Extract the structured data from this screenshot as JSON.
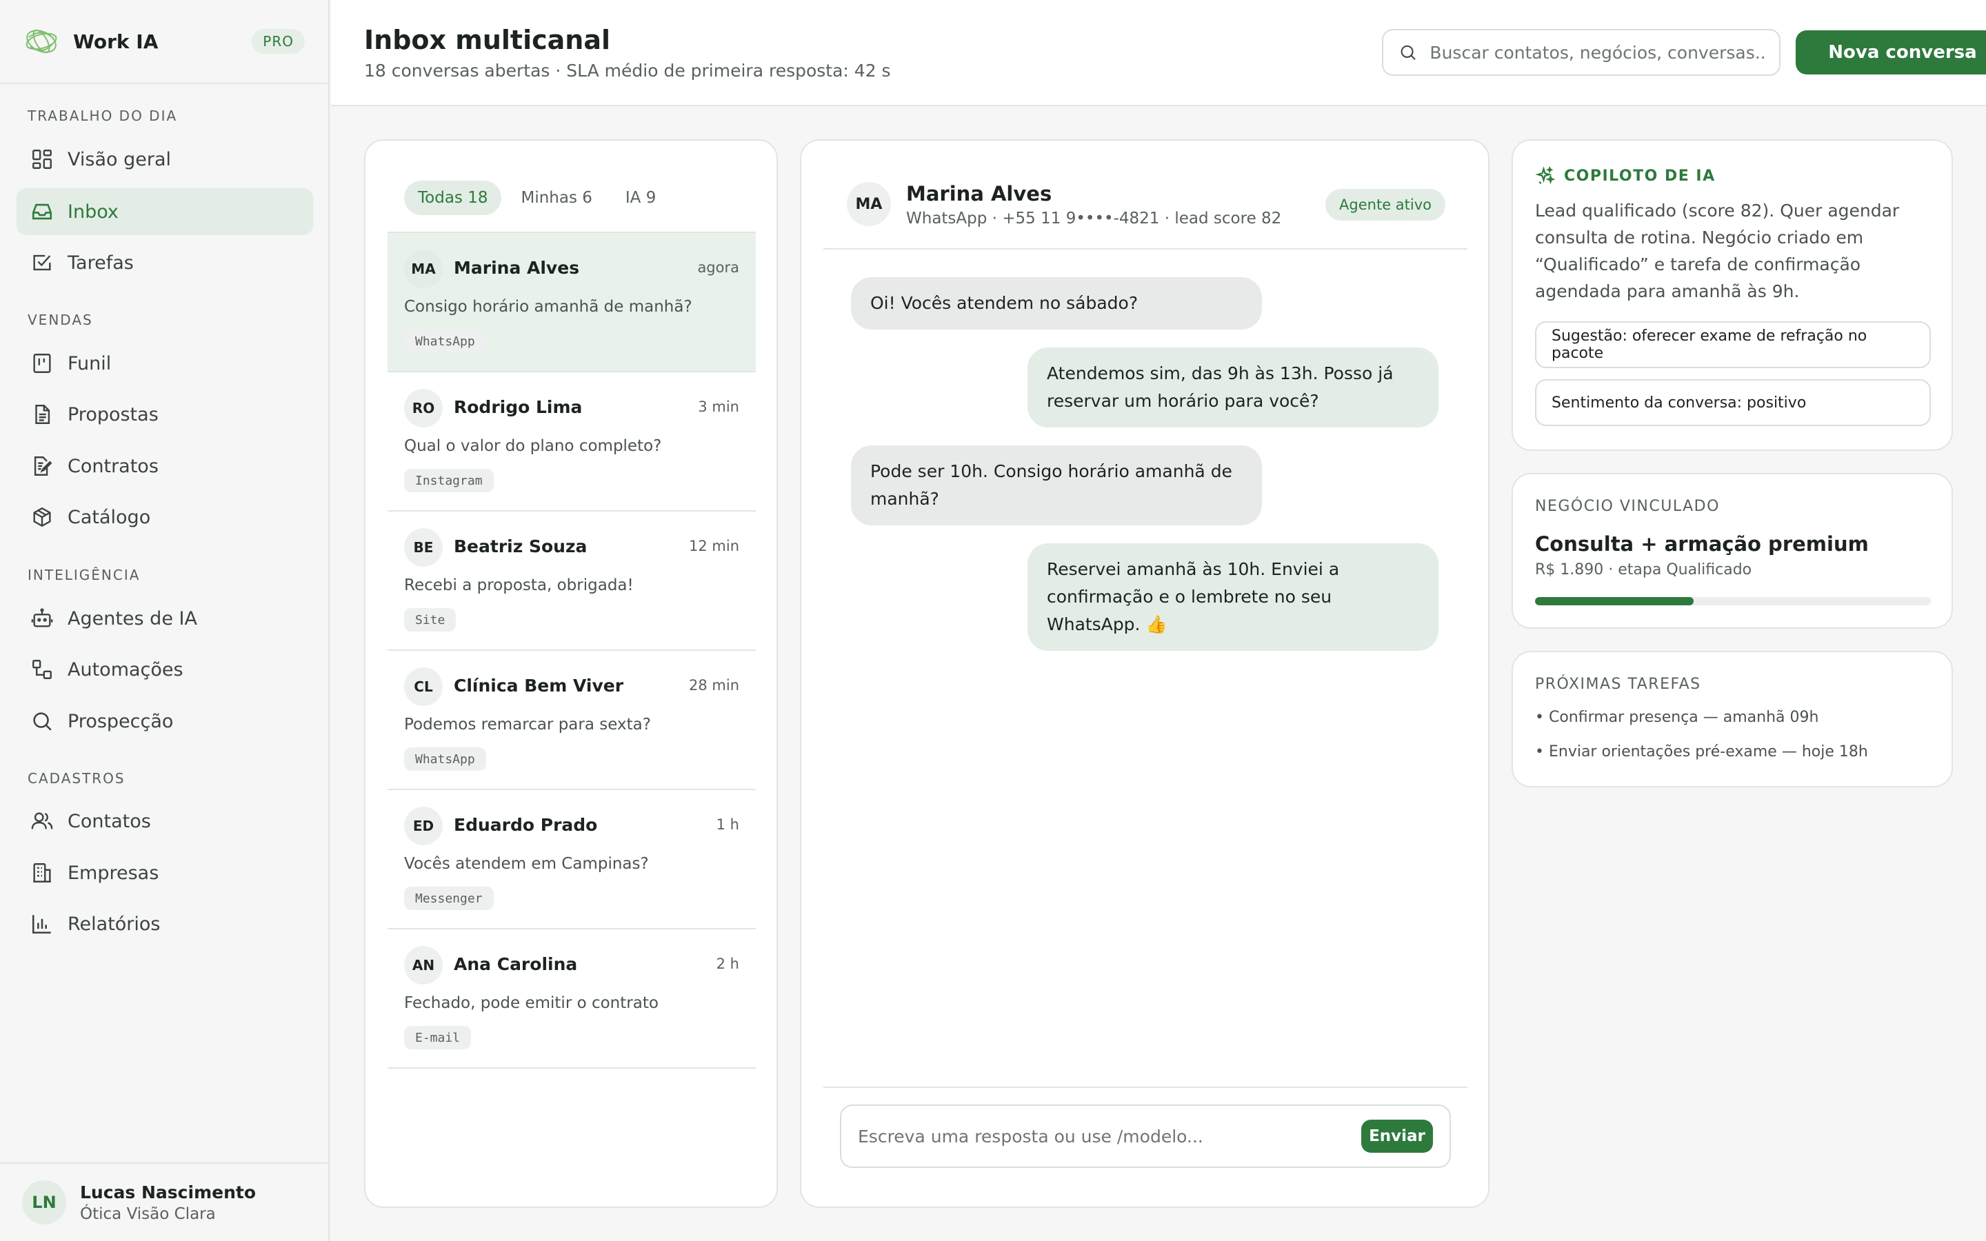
{
  "app": {
    "name": "Work IA",
    "plan_badge": "PRO"
  },
  "sidebar": {
    "sections": [
      {
        "title": "TRABALHO DO DIA",
        "items": [
          {
            "label": "Visão geral",
            "icon": "grid-icon"
          },
          {
            "label": "Inbox",
            "icon": "inbox-icon",
            "active": true
          },
          {
            "label": "Tarefas",
            "icon": "checkbox-icon"
          }
        ]
      },
      {
        "title": "VENDAS",
        "items": [
          {
            "label": "Funil",
            "icon": "kanban-icon"
          },
          {
            "label": "Propostas",
            "icon": "document-icon"
          },
          {
            "label": "Contratos",
            "icon": "contract-icon"
          },
          {
            "label": "Catálogo",
            "icon": "box-icon"
          }
        ]
      },
      {
        "title": "INTELIGÊNCIA",
        "items": [
          {
            "label": "Agentes de IA",
            "icon": "bot-icon"
          },
          {
            "label": "Automações",
            "icon": "workflow-icon"
          },
          {
            "label": "Prospecção",
            "icon": "search-icon"
          }
        ]
      },
      {
        "title": "CADASTROS",
        "items": [
          {
            "label": "Contatos",
            "icon": "users-icon"
          },
          {
            "label": "Empresas",
            "icon": "building-icon"
          },
          {
            "label": "Relatórios",
            "icon": "bar-chart-icon"
          }
        ]
      }
    ],
    "user": {
      "initials": "LN",
      "name": "Lucas Nascimento",
      "company": "Ótica Visão Clara"
    }
  },
  "header": {
    "title": "Inbox multicanal",
    "subtitle": "18 conversas abertas · SLA médio de primeira resposta: 42 s",
    "search_placeholder": "Buscar contatos, negócios, conversas...",
    "primary_button": "Nova conversa"
  },
  "conversations": {
    "tabs": [
      {
        "label": "Todas 18",
        "active": true
      },
      {
        "label": "Minhas 6"
      },
      {
        "label": "IA 9"
      }
    ],
    "items": [
      {
        "initials": "MA",
        "name": "Marina Alves",
        "time": "agora",
        "message": "Consigo horário amanhã de manhã?",
        "channel": "WhatsApp",
        "active": true
      },
      {
        "initials": "RO",
        "name": "Rodrigo Lima",
        "time": "3 min",
        "message": "Qual o valor do plano completo?",
        "channel": "Instagram"
      },
      {
        "initials": "BE",
        "name": "Beatriz Souza",
        "time": "12 min",
        "message": "Recebi a proposta, obrigada!",
        "channel": "Site"
      },
      {
        "initials": "CL",
        "name": "Clínica Bem Viver",
        "time": "28 min",
        "message": "Podemos remarcar para sexta?",
        "channel": "WhatsApp"
      },
      {
        "initials": "ED",
        "name": "Eduardo Prado",
        "time": "1 h",
        "message": "Vocês atendem em Campinas?",
        "channel": "Messenger"
      },
      {
        "initials": "AN",
        "name": "Ana Carolina",
        "time": "2 h",
        "message": "Fechado, pode emitir o contrato",
        "channel": "E-mail"
      }
    ]
  },
  "chat": {
    "contact_initials": "MA",
    "contact_name": "Marina Alves",
    "contact_meta": "WhatsApp · +55 11 9••••-4821 · lead score 82",
    "agent_status": "Agente ativo",
    "messages": [
      {
        "direction": "in",
        "text": "Oi! Vocês atendem no sábado?"
      },
      {
        "direction": "out",
        "text": "Atendemos sim, das 9h às 13h. Posso já reservar um horário para você?"
      },
      {
        "direction": "in",
        "text": "Pode ser 10h. Consigo horário amanhã de manhã?"
      },
      {
        "direction": "out",
        "text": "Reservei amanhã às 10h. Enviei a confirmação e o lembrete no seu WhatsApp. 👍"
      }
    ],
    "composer_placeholder": "Escreva uma resposta ou use /modelo...",
    "send_label": "Enviar"
  },
  "copilot": {
    "title": "COPILOTO DE IA",
    "summary": "Lead qualificado (score 82). Quer agendar consulta de rotina. Negócio criado em “Qualificado” e tarefa de confirmação agendada para amanhã às 9h.",
    "suggestion": "Sugestão: oferecer exame de refração no pacote",
    "sentiment": "Sentimento da conversa: positivo"
  },
  "deal": {
    "label": "NEGÓCIO VINCULADO",
    "title": "Consulta + armação premium",
    "subtitle": "R$ 1.890 · etapa Qualificado",
    "progress": 0.4
  },
  "tasks": {
    "label": "PRÓXIMAS TAREFAS",
    "items": [
      "• Confirmar presença — amanhã 09h",
      "• Enviar orientações pré-exame — hoje 18h"
    ]
  },
  "colors": {
    "accent": "#2d7a3c",
    "accent_soft": "#e3ede5"
  }
}
